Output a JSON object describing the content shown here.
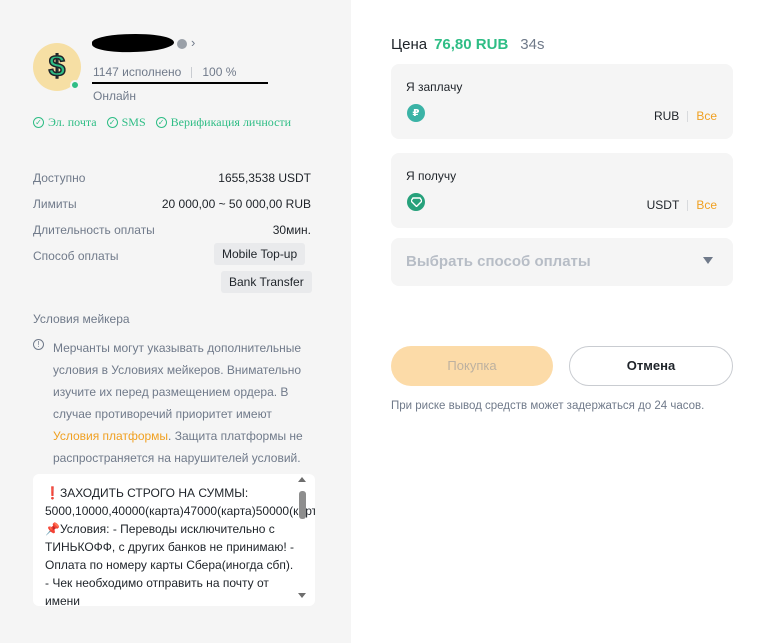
{
  "merchant": {
    "stats": {
      "orders": "1147 исполнено",
      "completion": "100 %"
    },
    "status": "Онлайн",
    "verifications": [
      "Эл. почта",
      "SMS",
      "Верификация личности"
    ]
  },
  "ad": {
    "available_label": "Доступно",
    "available_value": "1655,3538 USDT",
    "limits_label": "Лимиты",
    "limits_value": "20 000,00 ~ 50 000,00 RUB",
    "duration_label": "Длительность оплаты",
    "duration_value": "30мин.",
    "payment_label": "Способ оплаты",
    "payment_methods": [
      "Mobile Top-up",
      "Bank Transfer"
    ]
  },
  "terms": {
    "title": "Условия мейкера",
    "notice_before": "Мерчанты могут указывать дополнительные условия в Условиях мейкеров. Внимательно изучите их перед размещением ордера. В случае противоречий приоритет имеют ",
    "notice_link": "Условия платформы",
    "notice_after": ". Защита платформы не распространяется на нарушителей условий.",
    "maker_text": "❗ЗАХОДИТЬ СТРОГО НА СУММЫ: 5000,10000,40000(карта)47000(карта)50000(карта)❗📌Условия: - Переводы исключительно с ТИНЬКОФФ, с других банков не принимаю! - Оплата по номеру карты Сбера(иногда сбп). - Чек необходимо отправить на почту от имени"
  },
  "order": {
    "price_label": "Цена",
    "price_value": "76,80 RUB",
    "timer": "34s",
    "pay": {
      "label": "Я заплачу",
      "currency": "RUB",
      "all_label": "Все",
      "icon": "ruble-coin-icon"
    },
    "receive": {
      "label": "Я получу",
      "currency": "USDT",
      "all_label": "Все",
      "icon": "tether-coin-icon"
    },
    "payment_method_placeholder": "Выбрать способ оплаты",
    "buy_label": "Покупка",
    "cancel_label": "Отмена",
    "risk_note": "При риске вывод средств может задержаться до 24 часов."
  },
  "colors": {
    "accent_green": "#2ebd85",
    "accent_orange": "#f0a021",
    "buy_disabled": "#fcdba8"
  }
}
